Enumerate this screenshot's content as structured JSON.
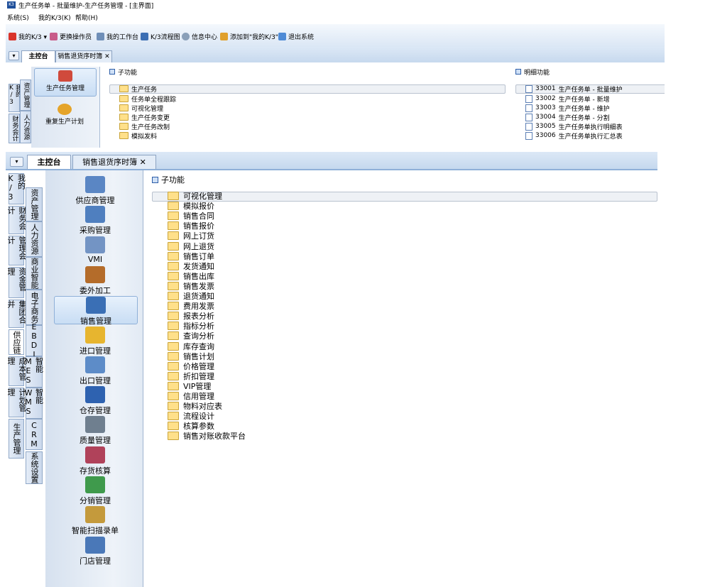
{
  "window1": {
    "title": "生产任务单 - 批量维护-生产任务管理 - [主界面]",
    "menu": [
      "系统(S)",
      "我的K/3(K)",
      "帮助(H)"
    ],
    "toolbar": [
      {
        "label": "我的K/3 ▾",
        "icon": "k3-icon",
        "color": "#d9342b"
      },
      {
        "label": "更换操作员",
        "icon": "user-switch-icon",
        "color": "#c85c8a"
      },
      {
        "label": "我的工作台",
        "icon": "workbench-icon",
        "color": "#6f8fb8"
      },
      {
        "label": "K/3流程图",
        "icon": "flowchart-icon",
        "color": "#3c6fb4"
      },
      {
        "label": "信息中心",
        "icon": "info-center-icon",
        "color": "#8aa0b9"
      },
      {
        "label": "添加到\"我的K/3\"",
        "icon": "add-favorite-icon",
        "color": "#e0a02c"
      },
      {
        "label": "退出系统",
        "icon": "exit-icon",
        "color": "#4f8bd6"
      }
    ],
    "tabs": {
      "main": "主控台",
      "second": "销售退货序时簿",
      "close": "✕"
    },
    "vtabs_col1": [
      "我的K/3",
      "财务会计"
    ],
    "vtabs_col2": [
      "资产管理",
      "人力资源"
    ],
    "nav": [
      {
        "label": "生产任务管理",
        "active": true
      },
      {
        "label": "重复生产计划",
        "active": false
      }
    ],
    "sub_header": "子功能",
    "sub_items": [
      "生产任务",
      "任务单全程跟踪",
      "可视化管理",
      "生产任务变更",
      "生产任务改制",
      "模拟发料"
    ],
    "detail_header": "明细功能",
    "detail_items": [
      {
        "code": "33001",
        "name": "生产任务单 - 批量维护"
      },
      {
        "code": "33002",
        "name": "生产任务单 - 新增"
      },
      {
        "code": "33003",
        "name": "生产任务单 - 维护"
      },
      {
        "code": "33004",
        "name": "生产任务单 - 分割"
      },
      {
        "code": "33005",
        "name": "生产任务单执行明细表"
      },
      {
        "code": "33006",
        "name": "生产任务单执行汇总表"
      }
    ]
  },
  "window2": {
    "tabs": {
      "main": "主控台",
      "second": "销售退货序时簿",
      "close": "✕"
    },
    "vtabs_col1": [
      "我的K/3",
      "财务会计",
      "管理会计",
      "资金管理",
      "集团合并",
      "供应链",
      "成本管理",
      "计划管理",
      "生产管理"
    ],
    "vtabs_col2": [
      "资产管理",
      "人力资源",
      "商业智能",
      "电子商务",
      "EBDI",
      "智能MES",
      "智能WMS",
      "CRM",
      "系统设置"
    ],
    "selected_vtab": "供应链",
    "nav": [
      {
        "label": "供应商管理",
        "icon": "supplier-icon",
        "color": "#5a86c4"
      },
      {
        "label": "采购管理",
        "icon": "purchase-icon",
        "color": "#4f7fbf"
      },
      {
        "label": "VMI",
        "icon": "vmi-icon",
        "color": "#7394c4"
      },
      {
        "label": "委外加工",
        "icon": "outsourcing-icon",
        "color": "#b46c2a"
      },
      {
        "label": "销售管理",
        "icon": "sales-icon",
        "color": "#3a6fb5"
      },
      {
        "label": "进口管理",
        "icon": "import-icon",
        "color": "#e7b52f"
      },
      {
        "label": "出口管理",
        "icon": "export-icon",
        "color": "#5d8cc8"
      },
      {
        "label": "仓存管理",
        "icon": "warehouse-icon",
        "color": "#2e62b0"
      },
      {
        "label": "质量管理",
        "icon": "quality-icon",
        "color": "#6f7f8f"
      },
      {
        "label": "存货核算",
        "icon": "inventory-icon",
        "color": "#b0425a"
      },
      {
        "label": "分销管理",
        "icon": "distribution-icon",
        "color": "#3f9a4c"
      },
      {
        "label": "智能扫描录单",
        "icon": "scanner-icon",
        "color": "#c49a3c"
      },
      {
        "label": "门店管理",
        "icon": "shop-icon",
        "color": "#4a78b8"
      }
    ],
    "active_nav": "销售管理",
    "sub_header": "子功能",
    "sub_items": [
      "可视化管理",
      "模拟报价",
      "销售合同",
      "销售报价",
      "网上订货",
      "网上退货",
      "销售订单",
      "发货通知",
      "销售出库",
      "销售发票",
      "退货通知",
      "费用发票",
      "报表分析",
      "指标分析",
      "查询分析",
      "库存查询",
      "销售计划",
      "价格管理",
      "折扣管理",
      "VIP管理",
      "信用管理",
      "物料对应表",
      "流程设计",
      "核算参数",
      "销售对账收款平台"
    ]
  }
}
